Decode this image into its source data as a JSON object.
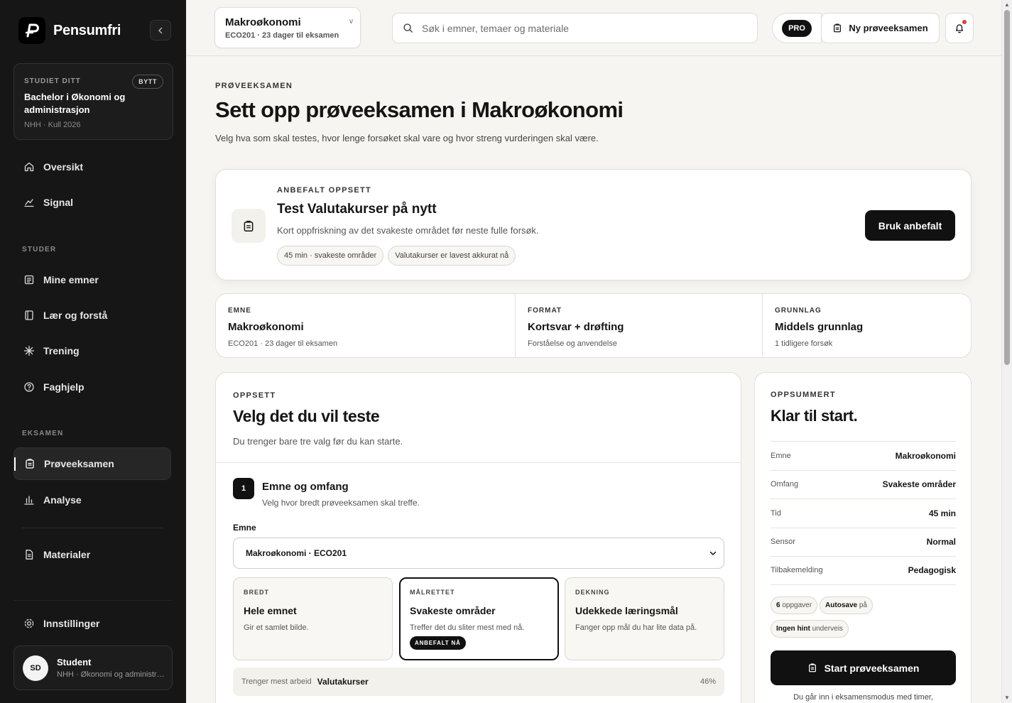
{
  "app": {
    "name": "Pensumfri"
  },
  "sidebar": {
    "study": {
      "eyebrow": "STUDIET DITT",
      "switch_label": "BYTT",
      "title": "Bachelor i Økonomi og administrasjon",
      "sub": "NHH · Kull 2026"
    },
    "nav_top": [
      {
        "label": "Oversikt"
      },
      {
        "label": "Signal"
      }
    ],
    "section_study": "STUDER",
    "nav_study": [
      {
        "label": "Mine emner"
      },
      {
        "label": "Lær og forstå"
      },
      {
        "label": "Trening"
      },
      {
        "label": "Faghjelp"
      }
    ],
    "section_exam": "EKSAMEN",
    "nav_exam": [
      {
        "label": "Prøveeksamen",
        "active": true
      },
      {
        "label": "Analyse"
      }
    ],
    "materials": "Materialer",
    "settings": "Innstillinger",
    "user": {
      "initials": "SD",
      "name": "Student",
      "sub": "NHH · Økonomi og administrasjon"
    }
  },
  "topbar": {
    "course": {
      "name": "Makroøkonomi",
      "sub": "ECO201 · 23 dager til eksamen"
    },
    "search_placeholder": "Søk i emner, temaer og materiale",
    "pro_badge": "PRO",
    "new_exam_label": "Ny prøveeksamen"
  },
  "main": {
    "eyebrow": "PRØVEEKSAMEN",
    "title": "Sett opp prøveeksamen i Makroøkonomi",
    "subtitle": "Velg hva som skal testes, hvor lenge forsøket skal vare og hvor streng vurderingen skal være.",
    "recommended": {
      "eyebrow": "ANBEFALT OPPSETT",
      "title": "Test Valutakurser på nytt",
      "desc": "Kort oppfriskning av det svakeste området før neste fulle forsøk.",
      "chips": [
        "45 min · svakeste områder",
        "Valutakurser er lavest akkurat nå"
      ],
      "button": "Bruk anbefalt"
    },
    "info": [
      {
        "label": "EMNE",
        "value": "Makroøkonomi",
        "sub": "ECO201 · 23 dager til eksamen"
      },
      {
        "label": "FORMAT",
        "value": "Kortsvar + drøfting",
        "sub": "Forståelse og anvendelse"
      },
      {
        "label": "GRUNNLAG",
        "value": "Middels grunnlag",
        "sub": "1 tidligere forsøk"
      }
    ],
    "setup": {
      "eyebrow": "OPPSETT",
      "title": "Velg det du vil teste",
      "subtitle": "Du trenger bare tre valg før du kan starte.",
      "step": {
        "number": "1",
        "title": "Emne og omfang",
        "sub": "Velg hvor bredt prøveeksamen skal treffe."
      },
      "field_label": "Emne",
      "selected_course": "Makroøkonomi · ECO201",
      "options": [
        {
          "eyebrow": "BREDT",
          "title": "Hele emnet",
          "desc": "Gir et samlet bilde.",
          "selected": false
        },
        {
          "eyebrow": "MÅLRETTET",
          "title": "Svakeste områder",
          "desc": "Treffer det du sliter mest med nå.",
          "badge": "ANBEFALT NÅ",
          "selected": true
        },
        {
          "eyebrow": "DEKNING",
          "title": "Udekkede læringsmål",
          "desc": "Fanger opp mål du har lite data på.",
          "selected": false
        }
      ],
      "work": {
        "label": "Trenger mest arbeid",
        "value": "Valutakurser",
        "pct": "46%"
      }
    },
    "summary": {
      "eyebrow": "OPPSUMMERT",
      "title": "Klar til start.",
      "rows": [
        {
          "k": "Emne",
          "v": "Makroøkonomi"
        },
        {
          "k": "Omfang",
          "v": "Svakeste områder"
        },
        {
          "k": "Tid",
          "v": "45 min"
        },
        {
          "k": "Sensor",
          "v": "Normal"
        },
        {
          "k": "Tilbakemelding",
          "v": "Pedagogisk"
        }
      ],
      "chips": [
        {
          "b": "6",
          "t": "oppgaver"
        },
        {
          "b": "Autosave",
          "t": "på"
        },
        {
          "b": "Ingen hint",
          "t": "underveis"
        }
      ],
      "start_button": "Start prøveeksamen",
      "note": "Du går inn i eksamensmodus med timer,"
    }
  }
}
